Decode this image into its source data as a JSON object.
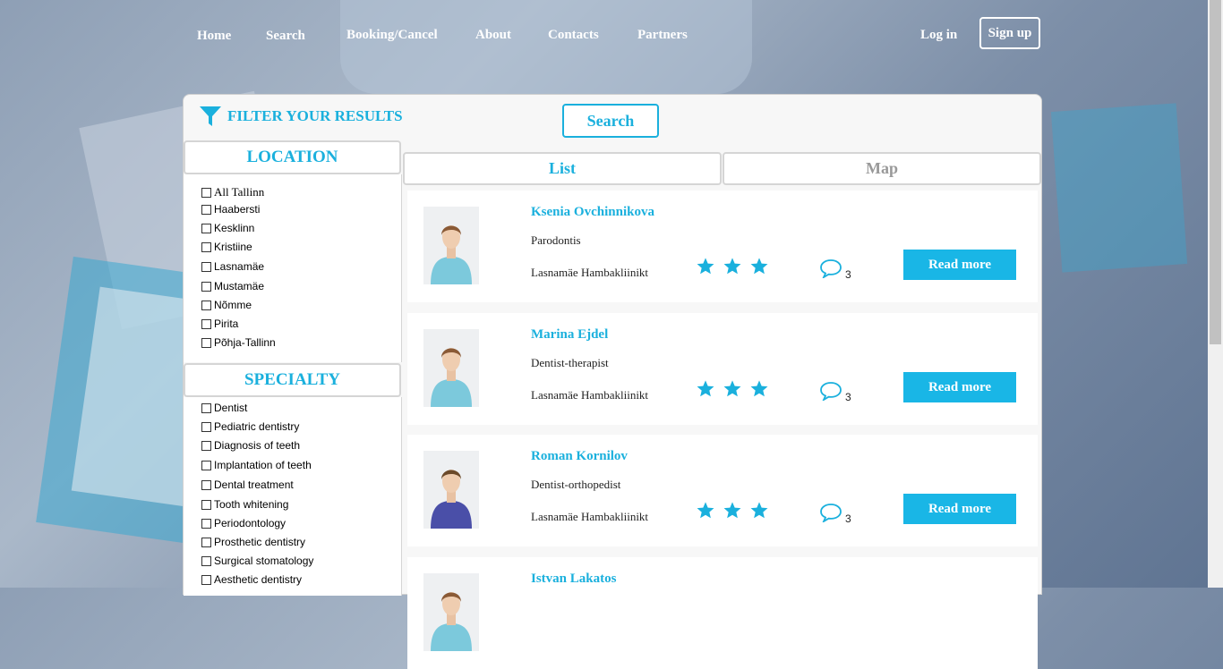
{
  "nav": {
    "home": "Home",
    "search": "Search",
    "booking": "Booking/Cancel",
    "about": "About",
    "contacts": "Contacts",
    "partners": "Partners",
    "login": "Log in",
    "signup": "Sign up"
  },
  "filter": {
    "title": "FILTER YOUR RESULTS",
    "search_label": "Search"
  },
  "location": {
    "heading": "LOCATION",
    "items": [
      "All Tallinn",
      "Haabersti",
      "Kesklinn",
      "Kristiine",
      "Lasnamäe",
      "Mustamäe",
      "Nõmme",
      "Pirita",
      "Põhja-Tallinn"
    ]
  },
  "specialty": {
    "heading": "SPECIALTY",
    "items": [
      "Dentist",
      "Pediatric dentistry",
      "Diagnosis of teeth",
      "Implantation of teeth",
      "Dental treatment",
      "Tooth whitening",
      "Periodontology",
      "Prosthetic dentistry",
      "Surgical stomatology",
      "Aesthetic dentistry"
    ]
  },
  "tabs": {
    "list": "List",
    "map": "Map"
  },
  "colors": {
    "accent": "#1ab0dd",
    "button": "#19b6e6"
  },
  "doctors": [
    {
      "name": "Ksenia Ovchinnikova",
      "specialty": "Parodontis",
      "clinic": "Lasnamäe Hambakliinikt",
      "rating": 3,
      "comments": "3",
      "read_more": "Read more"
    },
    {
      "name": "Marina Ejdel",
      "specialty": "Dentist-therapist",
      "clinic": "Lasnamäe Hambakliinikt",
      "rating": 3,
      "comments": "3",
      "read_more": "Read more"
    },
    {
      "name": "Roman Kornilov",
      "specialty": "Dentist-orthopedist",
      "clinic": "Lasnamäe Hambakliinikt",
      "rating": 3,
      "comments": "3",
      "read_more": "Read more"
    },
    {
      "name": "Istvan Lakatos"
    }
  ]
}
